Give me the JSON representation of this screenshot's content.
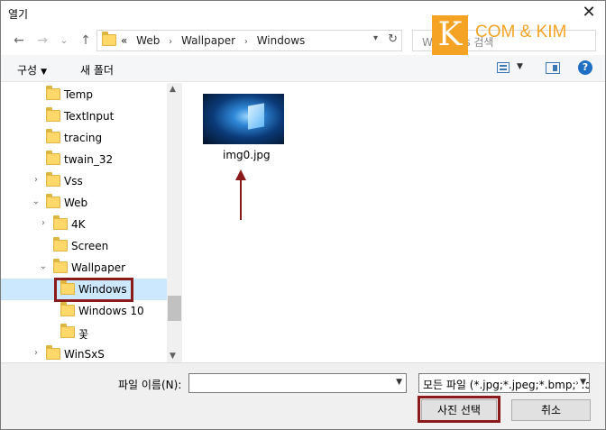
{
  "window": {
    "title": "열기",
    "close_glyph": "✕"
  },
  "nav": {
    "back_glyph": "←",
    "forward_glyph": "→",
    "recent_glyph": "⌄",
    "up_glyph": "↑",
    "breadcrumbs": [
      "«",
      "Web",
      "›",
      "Wallpaper",
      "›",
      "Windows"
    ],
    "search_placeholder": "Windows 검색"
  },
  "watermark": {
    "letter": "K",
    "text": "COM & KIM"
  },
  "toolbar": {
    "organize_label": "구성",
    "new_folder_label": "새 폴더",
    "help_glyph": "?"
  },
  "tree": {
    "items": [
      {
        "label": "Temp",
        "level": 1,
        "chevron": ""
      },
      {
        "label": "TextInput",
        "level": 1,
        "chevron": ""
      },
      {
        "label": "tracing",
        "level": 1,
        "chevron": ""
      },
      {
        "label": "twain_32",
        "level": 1,
        "chevron": ""
      },
      {
        "label": "Vss",
        "level": 1,
        "chevron": ">"
      },
      {
        "label": "Web",
        "level": 1,
        "chevron": "v"
      },
      {
        "label": "4K",
        "level": 2,
        "chevron": ">"
      },
      {
        "label": "Screen",
        "level": 2,
        "chevron": ""
      },
      {
        "label": "Wallpaper",
        "level": 2,
        "chevron": "v"
      },
      {
        "label": "Windows",
        "level": 3,
        "chevron": "",
        "selected": true
      },
      {
        "label": "Windows 10",
        "level": 3,
        "chevron": ""
      },
      {
        "label": "꽃",
        "level": 3,
        "chevron": ""
      },
      {
        "label": "WinSxS",
        "level": 1,
        "chevron": ">"
      }
    ]
  },
  "content": {
    "files": [
      {
        "name": "img0.jpg",
        "icon": "image-thumbnail"
      }
    ]
  },
  "footer": {
    "filename_label": "파일 이름(N):",
    "filename_value": "",
    "filetype_value": "모든 파일 (*.jpg;*.jpeg;*.bmp;*.d",
    "open_label": "사진 선택",
    "cancel_label": "취소"
  },
  "colors": {
    "accent": "#1f6fc5",
    "selection": "#cce8ff",
    "annotation": "#8b1a1a",
    "watermark": "#f5a325"
  }
}
